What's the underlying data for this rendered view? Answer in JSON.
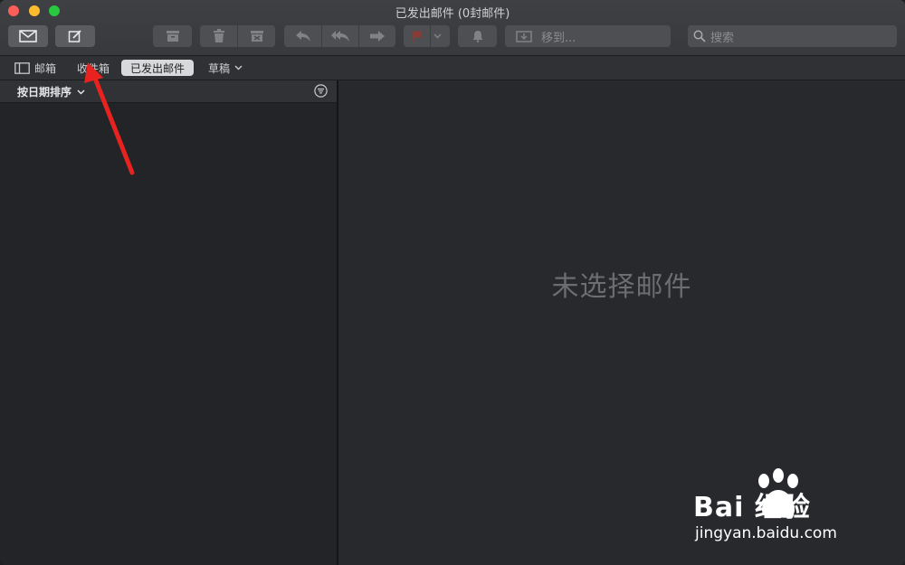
{
  "window": {
    "title": "已发出邮件 (0封邮件)"
  },
  "toolbar": {
    "move_to_placeholder": "移到...",
    "search_placeholder": "搜索",
    "flag_color": "#c9463d"
  },
  "favorites": {
    "mailboxes_label": "邮箱",
    "inbox_label": "收件箱",
    "sent_label": "已发出邮件",
    "drafts_label": "草稿"
  },
  "message_list": {
    "sort_label": "按日期排序"
  },
  "preview": {
    "empty_text": "未选择邮件"
  },
  "watermark": {
    "brand": "Bai 经验",
    "url": "jingyan.baidu.com"
  },
  "annotation": {
    "arrow_color": "#e8231f"
  }
}
